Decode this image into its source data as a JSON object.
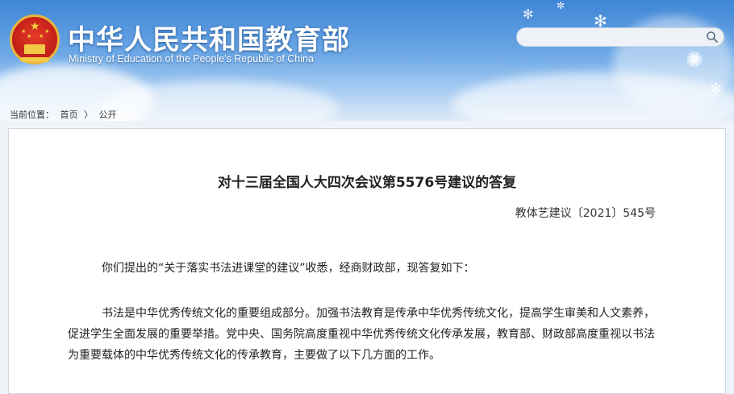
{
  "header": {
    "site_title": "中华人民共和国教育部",
    "site_subtitle": "Ministry of Education of the People's Republic of China",
    "search": {
      "value": "",
      "placeholder": ""
    }
  },
  "breadcrumb": {
    "prefix": "当前位置：",
    "items": [
      "首页",
      "公开"
    ],
    "separator": "〉"
  },
  "document": {
    "title": "对十三届全国人大四次会议第5576号建议的答复",
    "number": "教体艺建议〔2021〕545号",
    "paragraphs": [
      "你们提出的“关于落实书法进课堂的建议”收悉，经商财政部，现答复如下：",
      "书法是中华优秀传统文化的重要组成部分。加强书法教育是传承中华优秀传统文化，提高学生审美和人文素养，促进学生全面发展的重要举措。党中央、国务院高度重视中华优秀传统文化传承发展，教育部、财政部高度重视以书法为重要载体的中华优秀传统文化的传承教育，主要做了以下几方面的工作。"
    ]
  },
  "colors": {
    "header_blue": "#3f86d6",
    "emblem_red": "#c8231a",
    "emblem_gold": "#f3c847"
  },
  "icons": {
    "search": "search-icon",
    "emblem": "national-emblem-icon"
  }
}
